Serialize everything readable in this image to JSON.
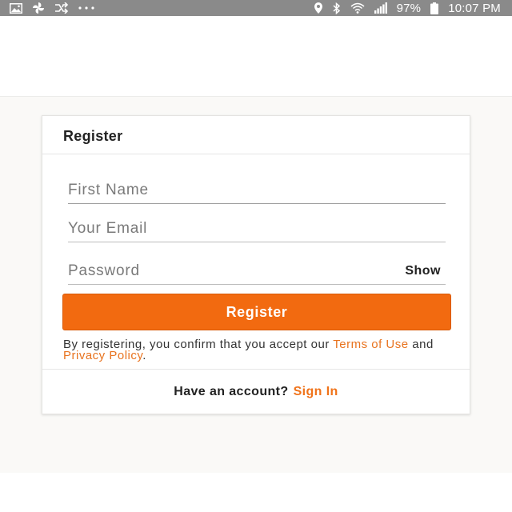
{
  "status_bar": {
    "left_icons": [
      "image-icon",
      "pinwheel-icon",
      "shuffle-icon",
      "more-dots-icon"
    ],
    "right_icons": [
      "location-icon",
      "bluetooth-icon",
      "wifi-icon",
      "signal-icon",
      "battery-icon"
    ],
    "battery": "97%",
    "time": "10:07 PM"
  },
  "card": {
    "title": "Register",
    "fields": {
      "first_name": {
        "placeholder": "First Name",
        "value": ""
      },
      "email": {
        "placeholder": "Your Email",
        "value": ""
      },
      "password": {
        "placeholder": "Password",
        "value": ""
      }
    },
    "show_label": "Show",
    "register_label": "Register",
    "legal": {
      "prefix": "By registering, you confirm that you accept our",
      "terms": "Terms of Use",
      "and": "and",
      "privacy": "Privacy Policy",
      "suffix": "."
    },
    "footer": {
      "text": "Have an account?",
      "link": "Sign In"
    }
  },
  "colors": {
    "accent": "#f26a10",
    "link": "#e8731f",
    "status_bar": "#8a8a8a",
    "page_bg": "#faf9f7"
  }
}
